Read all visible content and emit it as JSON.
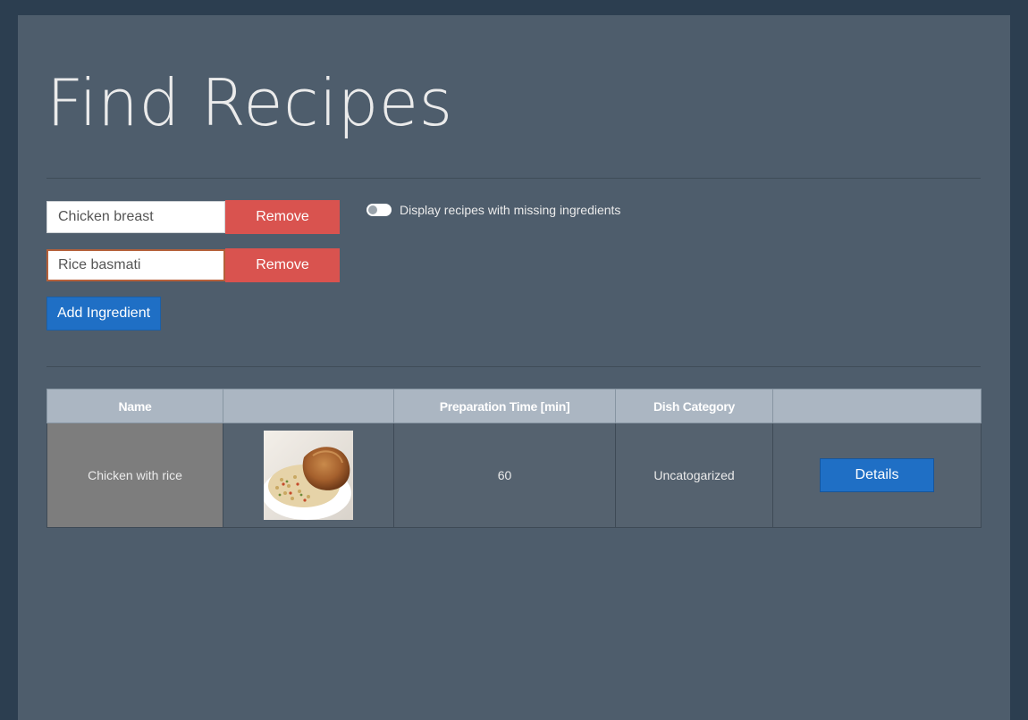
{
  "page": {
    "title": "Find Recipes"
  },
  "ingredients": [
    {
      "value": "Chicken breast",
      "remove_label": "Remove"
    },
    {
      "value": "Rice basmati",
      "remove_label": "Remove"
    }
  ],
  "add_ingredient_label": "Add Ingredient",
  "missing_toggle": {
    "label": "Display recipes with missing ingredients",
    "checked": false
  },
  "table": {
    "headers": [
      "Name",
      "",
      "Preparation Time [min]",
      "Dish Category",
      ""
    ],
    "rows": [
      {
        "name": "Chicken with rice",
        "image": "chicken-with-rice-photo",
        "prep_time": "60",
        "category": "Uncatogarized",
        "action_label": "Details"
      }
    ]
  },
  "colors": {
    "background": "#2c3e50",
    "panel": "#4e5d6c",
    "danger": "#d9534f",
    "primary": "#1f6fc5",
    "table_header": "#abb6c2"
  }
}
